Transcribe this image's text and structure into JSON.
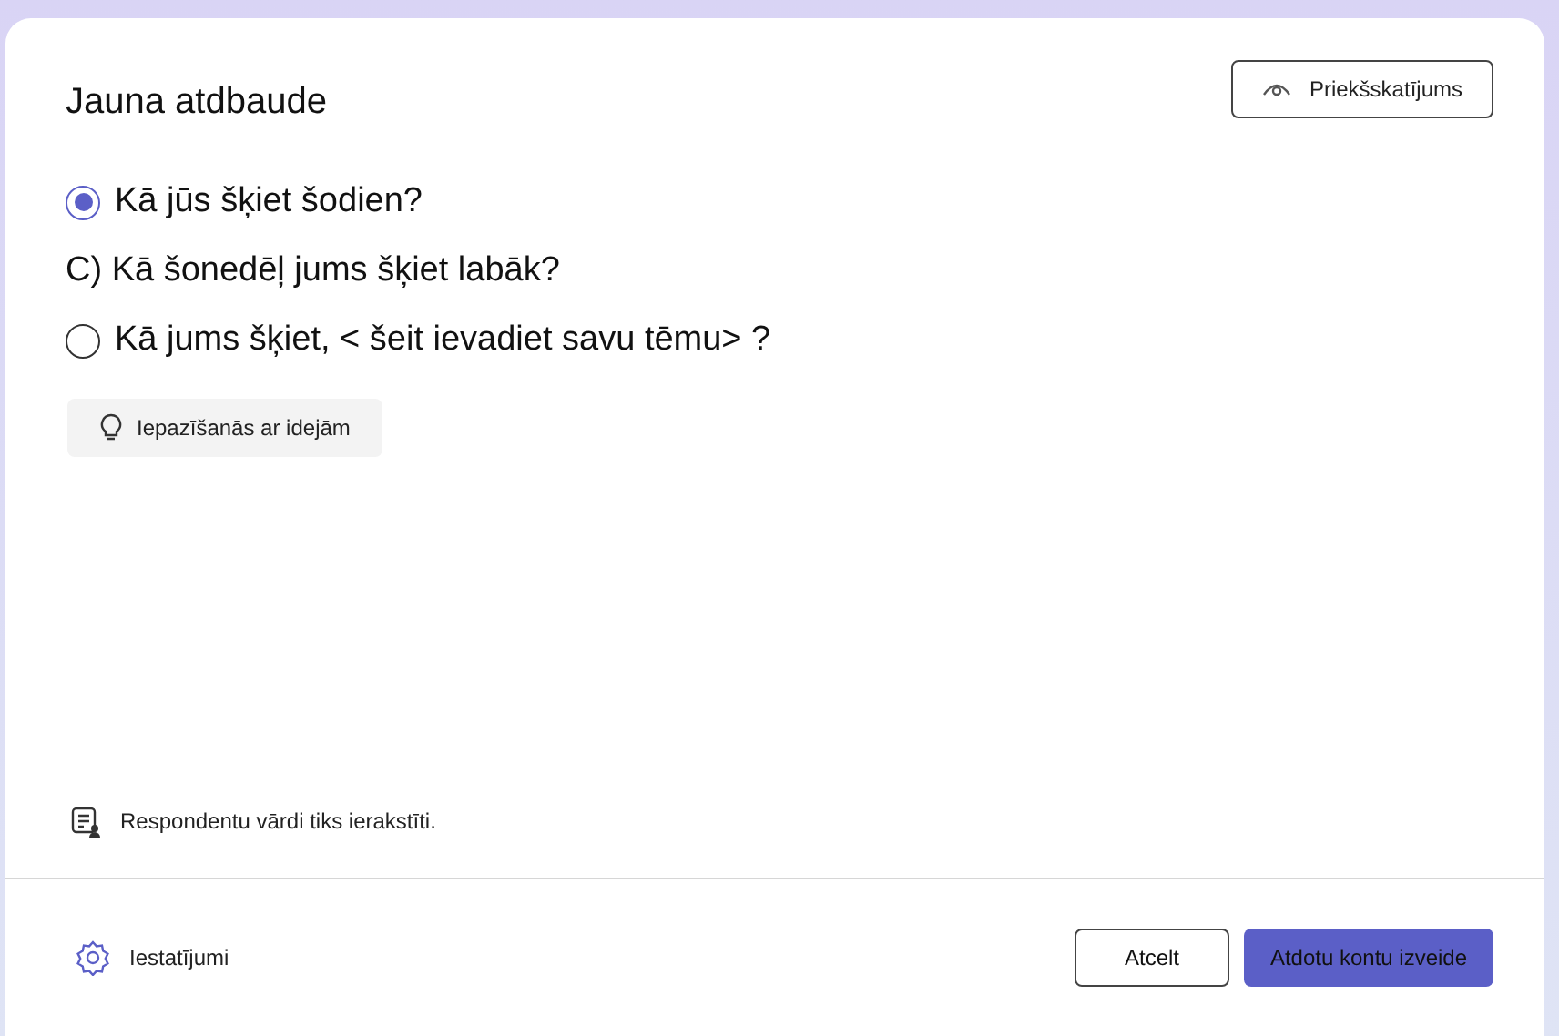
{
  "dialog": {
    "title": "Jauna atdbaude",
    "preview_button": "Priekšskatījums"
  },
  "options": [
    {
      "kind": "radio",
      "label": "Kā jūs šķiet šodien?",
      "selected": true
    },
    {
      "kind": "text",
      "label": "C) Kā šonedēļ jums šķiet labāk?"
    },
    {
      "kind": "radio",
      "label": "Kā jums šķiet, < šeit ievadiet savu tēmu> ?",
      "selected": false
    }
  ],
  "ideas_button": "Iepazīšanās ar idejām",
  "notice": "Respondentu vārdi tiks ierakstīti.",
  "footer": {
    "settings": "Iestatījumi",
    "cancel_button": "Atcelt",
    "create_button": "Atdotu kontu izveide"
  }
}
